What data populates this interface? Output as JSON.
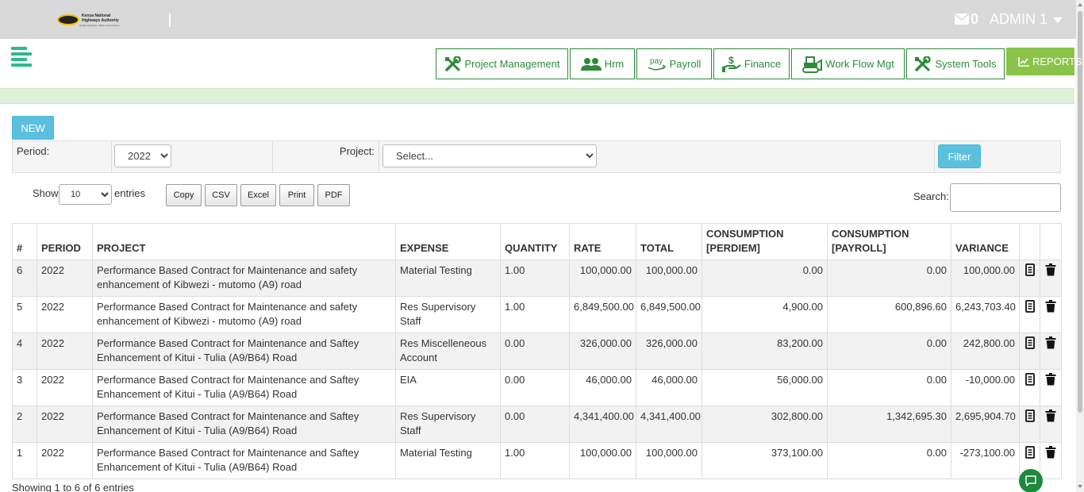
{
  "header": {
    "logo_text": [
      "Kenya National",
      "Highways Authority",
      "Quality Highways, Better Connections"
    ],
    "mail_count": "0",
    "user": "ADMIN 1"
  },
  "nav": [
    {
      "label": "Project Management",
      "icon": "tools-icon"
    },
    {
      "label": "Hrm",
      "icon": "users-icon"
    },
    {
      "label": "Payroll",
      "icon": "pay-icon",
      "icon_text": "pay"
    },
    {
      "label": "Finance",
      "icon": "hand-dollar-icon"
    },
    {
      "label": "Work Flow Mgt",
      "icon": "bulldozer-icon"
    },
    {
      "label": "System Tools",
      "icon": "tools-icon"
    },
    {
      "label": "REPORTS",
      "icon": "chart-icon"
    }
  ],
  "new_button": "NEW",
  "filter": {
    "period_label": "Period:",
    "period_value": "2022",
    "project_label": "Project:",
    "project_placeholder": "Select...",
    "filter_button": "Filter"
  },
  "length": {
    "show": "Show",
    "value": "10",
    "entries": "entries"
  },
  "export_buttons": [
    "Copy",
    "CSV",
    "Excel",
    "Print",
    "PDF"
  ],
  "search_label": "Search:",
  "table": {
    "columns": [
      "#",
      "PERIOD",
      "PROJECT",
      "EXPENSE",
      "QUANTITY",
      "RATE",
      "TOTAL",
      "CONSUMPTION [PERDIEM]",
      "CONSUMPTION [PAYROLL]",
      "VARIANCE"
    ],
    "rows": [
      {
        "id": "6",
        "period": "2022",
        "project": "Performance Based Contract for Maintenance and safety enhancement of Kibwezi - mutomo (A9) road",
        "expense": "Material Testing",
        "quantity": "1.00",
        "rate": "100,000.00",
        "total": "100,000.00",
        "perdiem": "0.00",
        "payroll": "0.00",
        "variance": "100,000.00"
      },
      {
        "id": "5",
        "period": "2022",
        "project": "Performance Based Contract for Maintenance and safety enhancement of Kibwezi - mutomo (A9) road",
        "expense": "Res Supervisory Staff",
        "quantity": "1.00",
        "rate": "6,849,500.00",
        "total": "6,849,500.00",
        "perdiem": "4,900.00",
        "payroll": "600,896.60",
        "variance": "6,243,703.40"
      },
      {
        "id": "4",
        "period": "2022",
        "project": "Performance Based Contract for Maintenance and Saftey Enhancement of Kitui - Tulia (A9/B64) Road",
        "expense": "Res Miscelleneous Account",
        "quantity": "0.00",
        "rate": "326,000.00",
        "total": "326,000.00",
        "perdiem": "83,200.00",
        "payroll": "0.00",
        "variance": "242,800.00"
      },
      {
        "id": "3",
        "period": "2022",
        "project": "Performance Based Contract for Maintenance and Saftey Enhancement of Kitui - Tulia (A9/B64) Road",
        "expense": "EIA",
        "quantity": "0.00",
        "rate": "46,000.00",
        "total": "46,000.00",
        "perdiem": "56,000.00",
        "payroll": "0.00",
        "variance": "-10,000.00"
      },
      {
        "id": "2",
        "period": "2022",
        "project": "Performance Based Contract for Maintenance and Saftey Enhancement of Kitui - Tulia (A9/B64) Road",
        "expense": "Res Supervisory Staff",
        "quantity": "0.00",
        "rate": "4,341,400.00",
        "total": "4,341,400.00",
        "perdiem": "302,800.00",
        "payroll": "1,342,695.30",
        "variance": "2,695,904.70"
      },
      {
        "id": "1",
        "period": "2022",
        "project": "Performance Based Contract for Maintenance and Saftey Enhancement of Kitui - Tulia (A9/B64) Road",
        "expense": "Material Testing",
        "quantity": "1.00",
        "rate": "100,000.00",
        "total": "100,000.00",
        "perdiem": "373,100.00",
        "payroll": "0.00",
        "variance": "-273,100.00"
      }
    ]
  },
  "info": "Showing 1 to 6 of 6 entries",
  "colors": {
    "topbar": "#d9d9d9",
    "nav_border": "#2e8b3a",
    "reports": "#8bc34a",
    "info_button": "#5bc0de",
    "band": "#dff0d8",
    "hamburger": "#2bbb8a"
  }
}
